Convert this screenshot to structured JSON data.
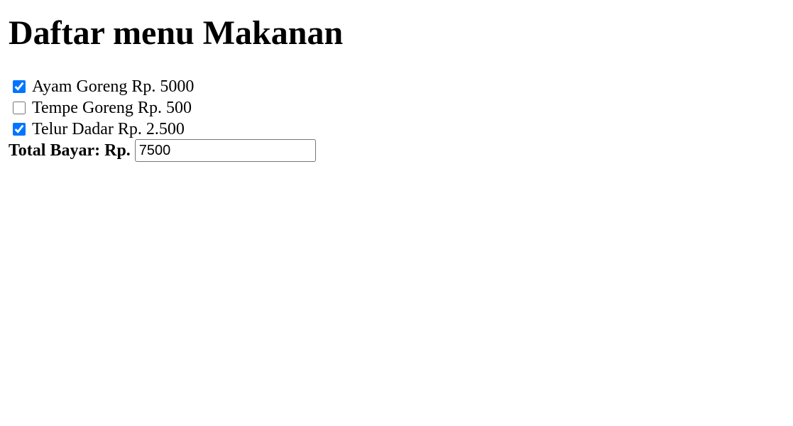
{
  "page": {
    "title": "Daftar menu Makanan"
  },
  "menu": {
    "items": [
      {
        "label": "Ayam Goreng Rp. 5000",
        "checked": true
      },
      {
        "label": "Tempe Goreng Rp. 500",
        "checked": false
      },
      {
        "label": "Telur Dadar Rp. 2.500",
        "checked": true
      }
    ]
  },
  "total": {
    "label": "Total Bayar: Rp.",
    "value": "7500"
  },
  "colors": {
    "checkbox_accent": "#0075ff"
  }
}
